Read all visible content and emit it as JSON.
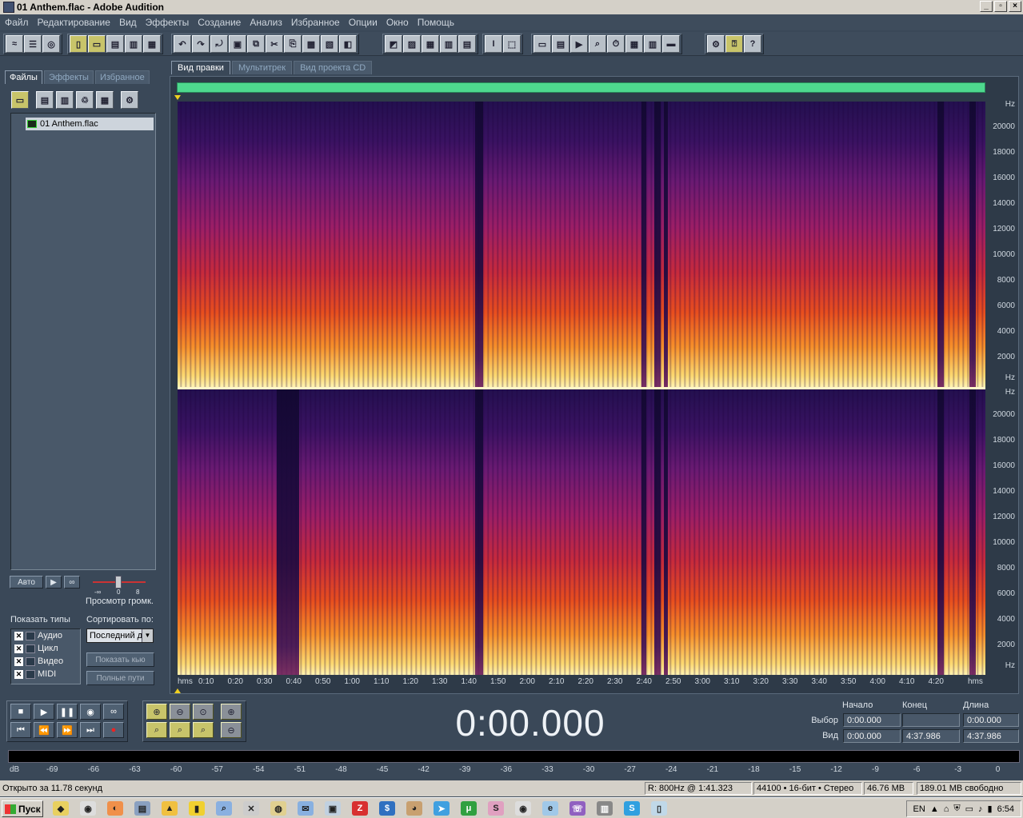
{
  "window": {
    "title": "01 Anthem.flac - Adobe Audition"
  },
  "menu": [
    "Файл",
    "Редактирование",
    "Вид",
    "Эффекты",
    "Создание",
    "Анализ",
    "Избранное",
    "Опции",
    "Окно",
    "Помощь"
  ],
  "left_panel": {
    "tabs": [
      "Файлы",
      "Эффекты",
      "Избранное"
    ],
    "active_tab": "Файлы",
    "files": [
      "01 Anthem.flac"
    ],
    "auto_button": "Авто",
    "preview_volume_label": "Просмотр громк.",
    "slider_ticks": [
      "-∞",
      "0",
      "8"
    ],
    "show_types_label": "Показать типы",
    "sort_label": "Сортировать по:",
    "sort_value": "Последний д",
    "types": [
      {
        "label": "Аудио",
        "checked": true
      },
      {
        "label": "Цикл",
        "checked": true
      },
      {
        "label": "Видео",
        "checked": true
      },
      {
        "label": "MIDI",
        "checked": true
      }
    ],
    "show_button": "Показать кью",
    "full_paths_button": "Полные пути"
  },
  "main_tabs": [
    "Вид правки",
    "Мультитрек",
    "Вид проекта CD"
  ],
  "active_main_tab": "Вид правки",
  "spectrogram": {
    "hz_unit": "Hz",
    "hz_ticks": [
      "20000",
      "18000",
      "16000",
      "14000",
      "12000",
      "10000",
      "8000",
      "6000",
      "4000",
      "2000"
    ],
    "time_unit": "hms",
    "time_ticks": [
      "0:10",
      "0:20",
      "0:30",
      "0:40",
      "0:50",
      "1:00",
      "1:10",
      "1:20",
      "1:30",
      "1:40",
      "1:50",
      "2:00",
      "2:10",
      "2:20",
      "2:30",
      "2:40",
      "2:50",
      "3:00",
      "3:10",
      "3:20",
      "3:30",
      "3:40",
      "3:50",
      "4:00",
      "4:10",
      "4:20"
    ]
  },
  "transport": {
    "time": "0:00.000",
    "headers": {
      "start": "Начало",
      "end": "Конец",
      "length": "Длина"
    },
    "rows": [
      {
        "label": "Выбор",
        "start": "0:00.000",
        "end": "",
        "length": "0:00.000"
      },
      {
        "label": "Вид",
        "start": "0:00.000",
        "end": "4:37.986",
        "length": "4:37.986"
      }
    ]
  },
  "meter": {
    "unit": "dB",
    "ticks": [
      "-69",
      "-66",
      "-63",
      "-60",
      "-57",
      "-54",
      "-51",
      "-48",
      "-45",
      "-42",
      "-39",
      "-36",
      "-33",
      "-30",
      "-27",
      "-24",
      "-21",
      "-18",
      "-15",
      "-12",
      "-9",
      "-6",
      "-3",
      "0"
    ]
  },
  "status": {
    "opened": "Открыто за 11.78 секунд",
    "cursor": "R: 800Hz @   1:41.323",
    "format": "44100 • 16-бит • Стерео",
    "size": "46.76 MB",
    "free": "189.01 MB свободно"
  },
  "taskbar": {
    "start": "Пуск",
    "lang": "EN",
    "clock": "6:54"
  }
}
